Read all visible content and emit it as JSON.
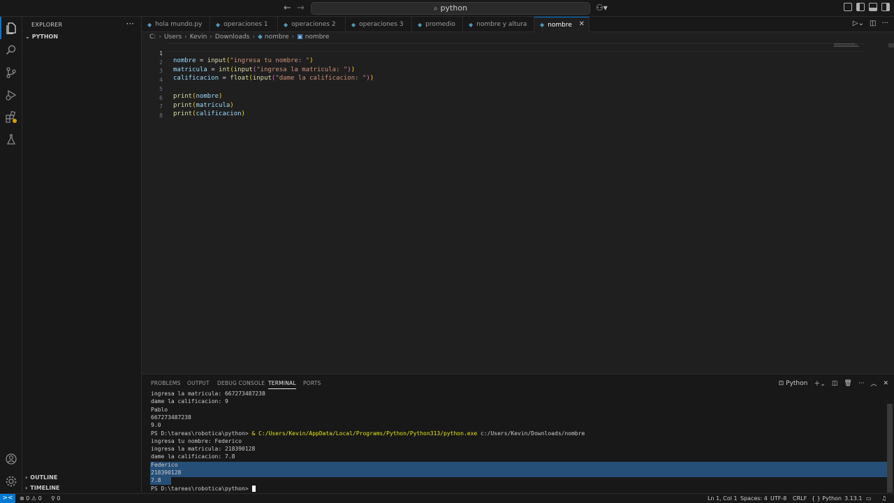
{
  "titlebar": {
    "back": "←",
    "forward": "→",
    "search": "python",
    "search_icon": "⌕",
    "copilot": "⚇▾"
  },
  "sidebar": {
    "title": "EXPLORER",
    "more": "···",
    "folder": "PYTHON",
    "outline": "OUTLINE",
    "timeline": "TIMELINE"
  },
  "tabs": [
    {
      "label": "hola mundo.py"
    },
    {
      "label": "operaciones 1"
    },
    {
      "label": "operaciones 2"
    },
    {
      "label": "operaciones 3"
    },
    {
      "label": "promedio"
    },
    {
      "label": "nombre y altura"
    },
    {
      "label": "nombre",
      "active": true,
      "close": "✕"
    }
  ],
  "breadcrumb": [
    "C:",
    "Users",
    "Kevin",
    "Downloads",
    "nombre",
    "nombre"
  ],
  "editor": {
    "lines": [
      {
        "n": "1"
      },
      {
        "n": "2"
      },
      {
        "n": "3"
      },
      {
        "n": "4"
      },
      {
        "n": "5"
      },
      {
        "n": "6"
      },
      {
        "n": "7"
      },
      {
        "n": "8"
      }
    ],
    "code": {
      "l1_var": "nombre",
      "l1_eq": " = ",
      "l1_fn": "input",
      "l1_str": "\"ingresa tu nombre: \"",
      "l2_var": "matricula",
      "l2_eq": " = ",
      "l2_fn1": "int",
      "l2_fn2": "input",
      "l2_str": "\"ingresa la matricula: \"",
      "l3_var": "calificacion",
      "l3_eq": " = ",
      "l3_fn1": "float",
      "l3_fn2": "input",
      "l3_str": "\"dame la calificacion: \"",
      "l5_fn": "print",
      "l5_arg": "nombre",
      "l6_fn": "print",
      "l6_arg": "matricula",
      "l7_fn": "print",
      "l7_arg": "calificacion"
    }
  },
  "panel": {
    "tabs": [
      "PROBLEMS",
      "OUTPUT",
      "DEBUG CONSOLE",
      "TERMINAL",
      "PORTS"
    ],
    "active_tab": "TERMINAL",
    "shell_label": "Python",
    "terminal": {
      "l1": "ingresa la matricula: 667273487238",
      "l2": "dame la calificacion: 9",
      "l3": "Pablo",
      "l4": "667273487238",
      "l5": "9.0",
      "l6_prompt": "PS D:\\tareas\\robotica\\python> ",
      "l6_amp": "& ",
      "l6_exe": "C:/Users/Kevin/AppData/Local/Programs/Python/Python313/python.exe",
      "l6_arg": " c:/Users/Kevin/Downloads/nombre",
      "l7": "ingresa tu nombre: Federico",
      "l8": "ingresa la matricula: 218390128",
      "l9": "dame la calificacion: 7.8",
      "l10": "Federico",
      "l11": "218390128",
      "l12": "7.8",
      "l13": "PS D:\\tareas\\robotica\\python> "
    }
  },
  "statusbar": {
    "remote": "><",
    "errors": "⊗ 0",
    "warnings": "⚠ 0",
    "ports": "⚲ 0",
    "position": "Ln 1, Col 1",
    "spaces": "Spaces: 4",
    "encoding": "UTF-8",
    "eol": "CRLF",
    "language": "{ } Python",
    "version": "3.13.1",
    "accent": "#0078d4"
  }
}
